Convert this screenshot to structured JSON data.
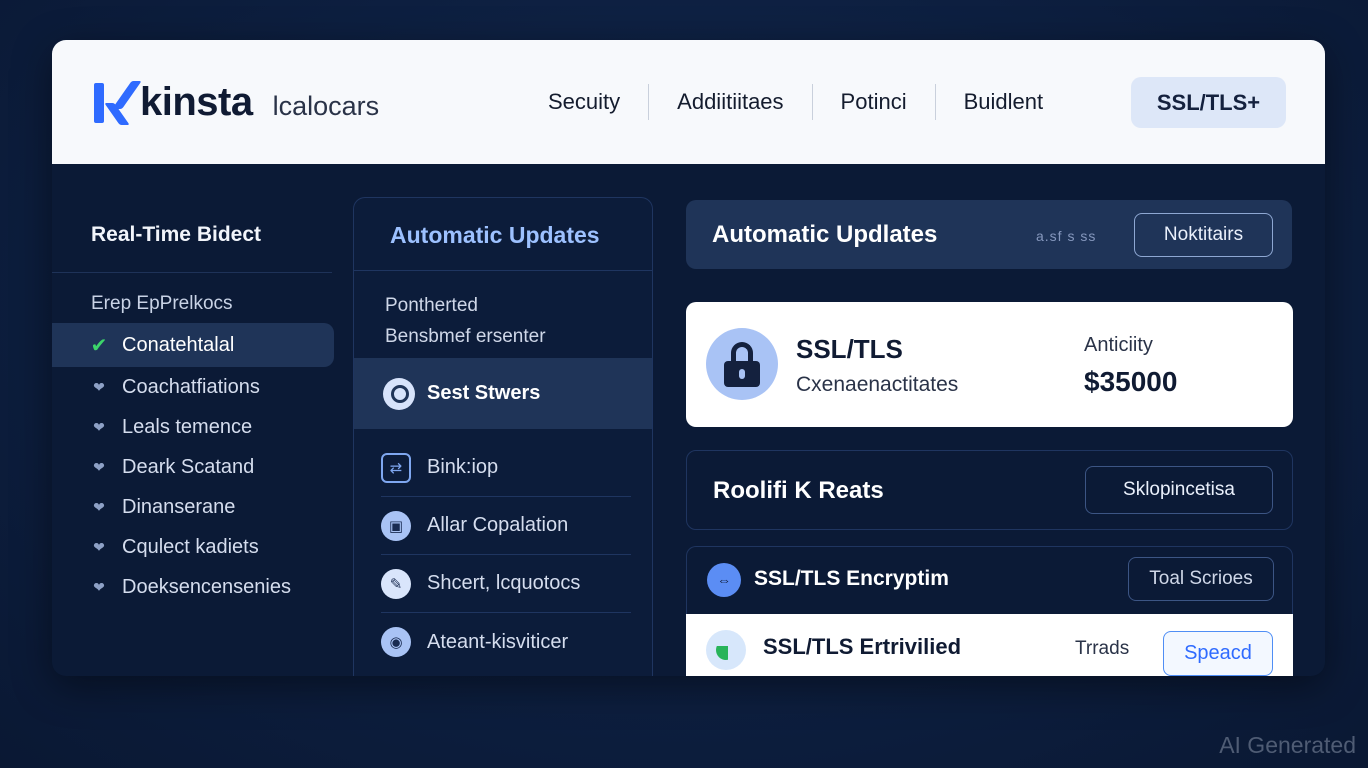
{
  "header": {
    "brand": "kinsta",
    "subtitle": "lcalocars",
    "nav": [
      "Secuity",
      "Addiitiitaes",
      "Potinci",
      "Buidlent"
    ],
    "cta_label": "SSL/TLS+"
  },
  "left": {
    "title": "Real-Time Bidect",
    "subtitle": "Erep EpPrelkocs",
    "items": [
      {
        "label": "Conatehtalal",
        "active": true
      },
      {
        "label": "Coachatfiations"
      },
      {
        "label": "Leals temence"
      },
      {
        "label": "Deark Scatand"
      },
      {
        "label": "Dinanserane"
      },
      {
        "label": "Cqulect kadiets"
      },
      {
        "label": "Doeksencensenies"
      }
    ]
  },
  "middle": {
    "title": "Automatic Updates",
    "sub1": "Pontherted",
    "sub2": "Bensbmef ersenter",
    "active_label": "Sest Stwers",
    "items": [
      {
        "label": "Bink:iop"
      },
      {
        "label": "Allar Copalation"
      },
      {
        "label": "Shcert, lcquotocs"
      },
      {
        "label": "Ateant-kisviticer"
      }
    ]
  },
  "right": {
    "head_title": "Automatic Updlates",
    "head_mini": "a.sf s ss",
    "head_button": "Noktitairs",
    "ssl_title": "SSL/TLS",
    "ssl_sub": "Cxenaenactitates",
    "ssl_avail_label": "Anticiity",
    "ssl_price": "$35000",
    "row_title": "Roolifi K Reats",
    "row_button": "Sklopincetisa",
    "enc_title": "SSL/TLS Encryptim",
    "enc_button": "Toal Scrioes",
    "bottom_title": "SSL/TLS  Ertrivilied",
    "bottom_label": "Trrads",
    "bottom_button": "Speacd"
  },
  "watermark": "AI Generated",
  "colors": {
    "accent": "#2f6bff",
    "background": "#0d1f40",
    "active": "#1f3458",
    "check": "#3cd46a"
  }
}
